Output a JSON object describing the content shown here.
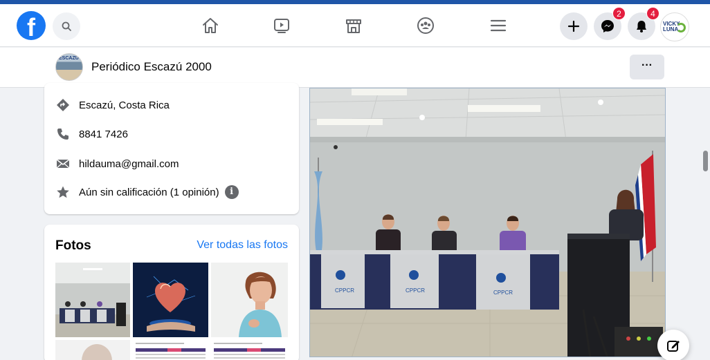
{
  "nav": {
    "logo_letter": "f",
    "messenger_badge": "2",
    "notifications_badge": "4",
    "profile_initials": "VICKY LUNA"
  },
  "page": {
    "name": "Periódico Escazú 2000",
    "avatar_text": "ESCAZÚ",
    "more_label": "···"
  },
  "info": {
    "location": "Escazú, Costa Rica",
    "phone": "8841 7426",
    "email": "hildauma@gmail.com",
    "rating": "Aún sin calificación (1 opinión)",
    "info_glyph": "i"
  },
  "photos": {
    "title": "Fotos",
    "see_all": "Ver todas las fotos"
  },
  "main_photo": {
    "banner_text": "CPPCR"
  },
  "colors": {
    "brand": "#1877f2",
    "badge": "#e41e3f",
    "top_stripe": "#1f56a8"
  }
}
